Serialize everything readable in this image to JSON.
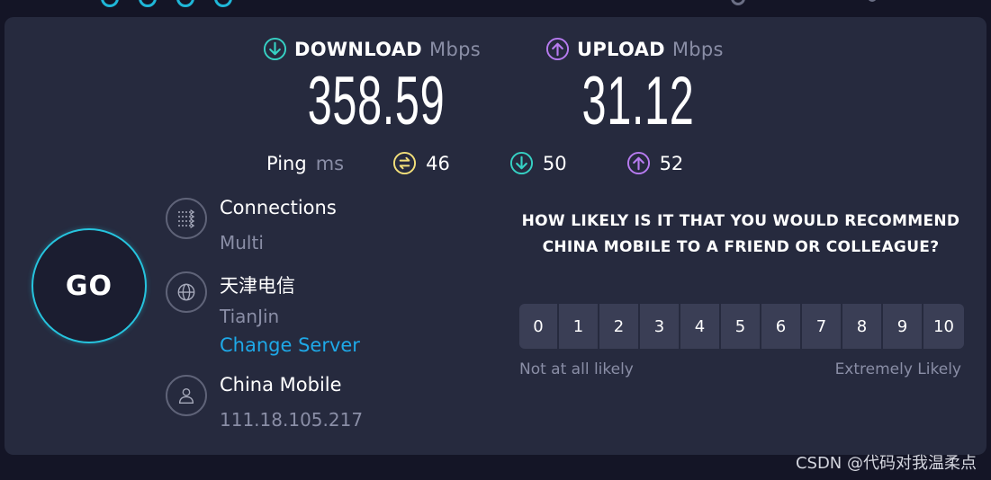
{
  "download": {
    "label": "DOWNLOAD",
    "unit": "Mbps",
    "value": "358.59",
    "icon": "arrow-down-circle-icon",
    "color": "#36d1c4"
  },
  "upload": {
    "label": "UPLOAD",
    "unit": "Mbps",
    "value": "31.12",
    "icon": "arrow-up-circle-icon",
    "color": "#b77bf0"
  },
  "ping": {
    "label": "Ping",
    "unit": "ms",
    "idle": {
      "value": "46",
      "icon": "ping-idle-icon",
      "color": "#f2df7a"
    },
    "down": {
      "value": "50",
      "icon": "ping-down-icon",
      "color": "#36d1c4"
    },
    "up": {
      "value": "52",
      "icon": "ping-up-icon",
      "color": "#b77bf0"
    }
  },
  "go_button": {
    "label": "GO"
  },
  "connections": {
    "title": "Connections",
    "value": "Multi",
    "icon": "connections-icon"
  },
  "server": {
    "name": "天津电信",
    "location": "TianJin",
    "change_link": "Change Server",
    "icon": "globe-icon"
  },
  "provider": {
    "name": "China Mobile",
    "ip": "111.18.105.217",
    "icon": "user-icon"
  },
  "survey": {
    "question": "HOW LIKELY IS IT THAT YOU WOULD RECOMMEND CHINA MOBILE TO A FRIEND OR COLLEAGUE?",
    "scale": [
      "0",
      "1",
      "2",
      "3",
      "4",
      "5",
      "6",
      "7",
      "8",
      "9",
      "10"
    ],
    "low_label": "Not at all likely",
    "high_label": "Extremely Likely"
  },
  "watermark": "CSDN @代码对我温柔点"
}
